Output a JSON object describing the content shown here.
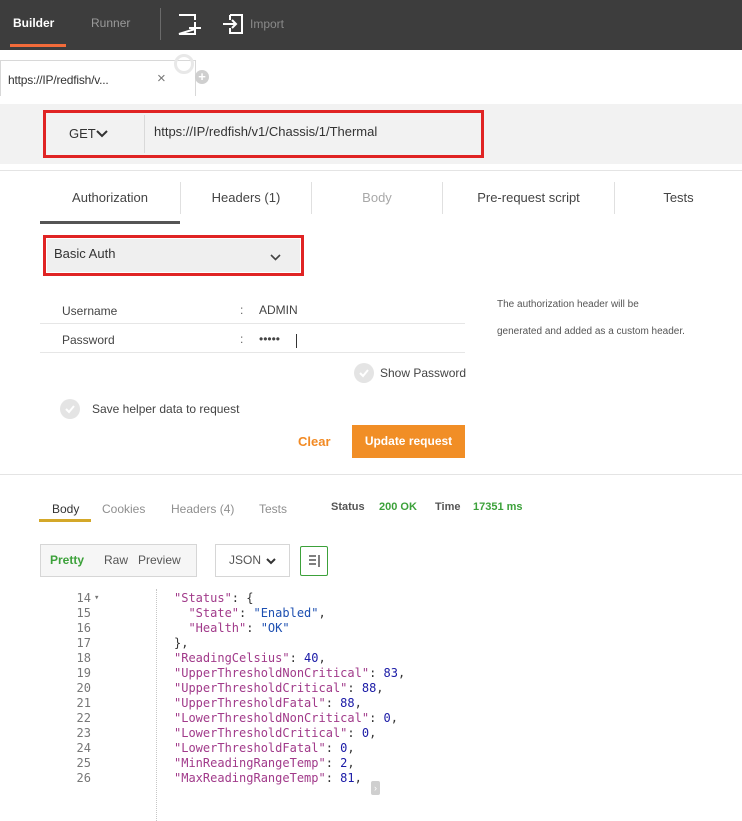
{
  "topbar": {
    "builder_label": "Builder",
    "runner_label": "Runner",
    "import_label": "Import",
    "new_tab_icon": "new-tab-icon",
    "import_icon": "import-icon",
    "accent": "#f26b3a"
  },
  "request_tab": {
    "label": "https://IP/redfish/v...",
    "close_glyph": "×",
    "add_glyph": "+"
  },
  "request": {
    "method": "GET",
    "url": "https://IP/redfish/v1/Chassis/1/Thermal"
  },
  "builder_tabs": [
    {
      "label": "Authorization",
      "active": true
    },
    {
      "label": "Headers (1)",
      "active": false
    },
    {
      "label": "Body",
      "active": false,
      "disabled": true
    },
    {
      "label": "Pre-request script",
      "active": false
    },
    {
      "label": "Tests",
      "active": false
    }
  ],
  "auth": {
    "type": "Basic Auth",
    "username_label": "Username",
    "username_value": "ADMIN",
    "password_label": "Password",
    "password_value": "•••••",
    "colon": ":",
    "help_line1": "The authorization header will be",
    "help_line2": "generated and added as a custom header.",
    "show_password_label": "Show Password",
    "save_helper_label": "Save helper data to request",
    "clear_label": "Clear",
    "update_label": "Update request",
    "button_color": "#f18e26"
  },
  "response": {
    "tabs": [
      {
        "label": "Body",
        "active": true
      },
      {
        "label": "Cookies",
        "active": false
      },
      {
        "label": "Headers (4)",
        "active": false
      },
      {
        "label": "Tests",
        "active": false
      }
    ],
    "status_label": "Status",
    "status_value": "200 OK",
    "time_label": "Time",
    "time_value": "17351 ms",
    "status_color": "#3ca13a",
    "formats": [
      "Pretty",
      "Raw",
      "Preview"
    ],
    "active_format": "Pretty",
    "language": "JSON",
    "wrap_icon": "wrap-lines-icon"
  },
  "code_lines": [
    {
      "num": "14",
      "fold": "▾",
      "indent": "",
      "key": "\"Status\"",
      "rest": ": {",
      "vtype": ""
    },
    {
      "num": "15",
      "fold": "",
      "indent": "  ",
      "key": "\"State\"",
      "rest": ": ",
      "value": "\"Enabled\"",
      "tail": ",",
      "vtype": "s"
    },
    {
      "num": "16",
      "fold": "",
      "indent": "  ",
      "key": "\"Health\"",
      "rest": ": ",
      "value": "\"OK\"",
      "tail": "",
      "vtype": "s"
    },
    {
      "num": "17",
      "fold": "",
      "indent": "",
      "key": "",
      "rest": "},",
      "vtype": ""
    },
    {
      "num": "18",
      "fold": "",
      "indent": "",
      "key": "\"ReadingCelsius\"",
      "rest": ": ",
      "value": "40",
      "tail": ",",
      "vtype": "n"
    },
    {
      "num": "19",
      "fold": "",
      "indent": "",
      "key": "\"UpperThresholdNonCritical\"",
      "rest": ": ",
      "value": "83",
      "tail": ",",
      "vtype": "n"
    },
    {
      "num": "20",
      "fold": "",
      "indent": "",
      "key": "\"UpperThresholdCritical\"",
      "rest": ": ",
      "value": "88",
      "tail": ",",
      "vtype": "n"
    },
    {
      "num": "21",
      "fold": "",
      "indent": "",
      "key": "\"UpperThresholdFatal\"",
      "rest": ": ",
      "value": "88",
      "tail": ",",
      "vtype": "n"
    },
    {
      "num": "22",
      "fold": "",
      "indent": "",
      "key": "\"LowerThresholdNonCritical\"",
      "rest": ": ",
      "value": "0",
      "tail": ",",
      "vtype": "n"
    },
    {
      "num": "23",
      "fold": "",
      "indent": "",
      "key": "\"LowerThresholdCritical\"",
      "rest": ": ",
      "value": "0",
      "tail": ",",
      "vtype": "n"
    },
    {
      "num": "24",
      "fold": "",
      "indent": "",
      "key": "\"LowerThresholdFatal\"",
      "rest": ": ",
      "value": "0",
      "tail": ",",
      "vtype": "n"
    },
    {
      "num": "25",
      "fold": "",
      "indent": "",
      "key": "\"MinReadingRangeTemp\"",
      "rest": ": ",
      "value": "2",
      "tail": ",",
      "vtype": "n"
    },
    {
      "num": "26",
      "fold": "",
      "indent": "",
      "key": "\"MaxReadingRangeTemp\"",
      "rest": ": ",
      "value": "81",
      "tail": ",",
      "vtype": "n"
    }
  ],
  "highlight_frame_color": "#e02424"
}
